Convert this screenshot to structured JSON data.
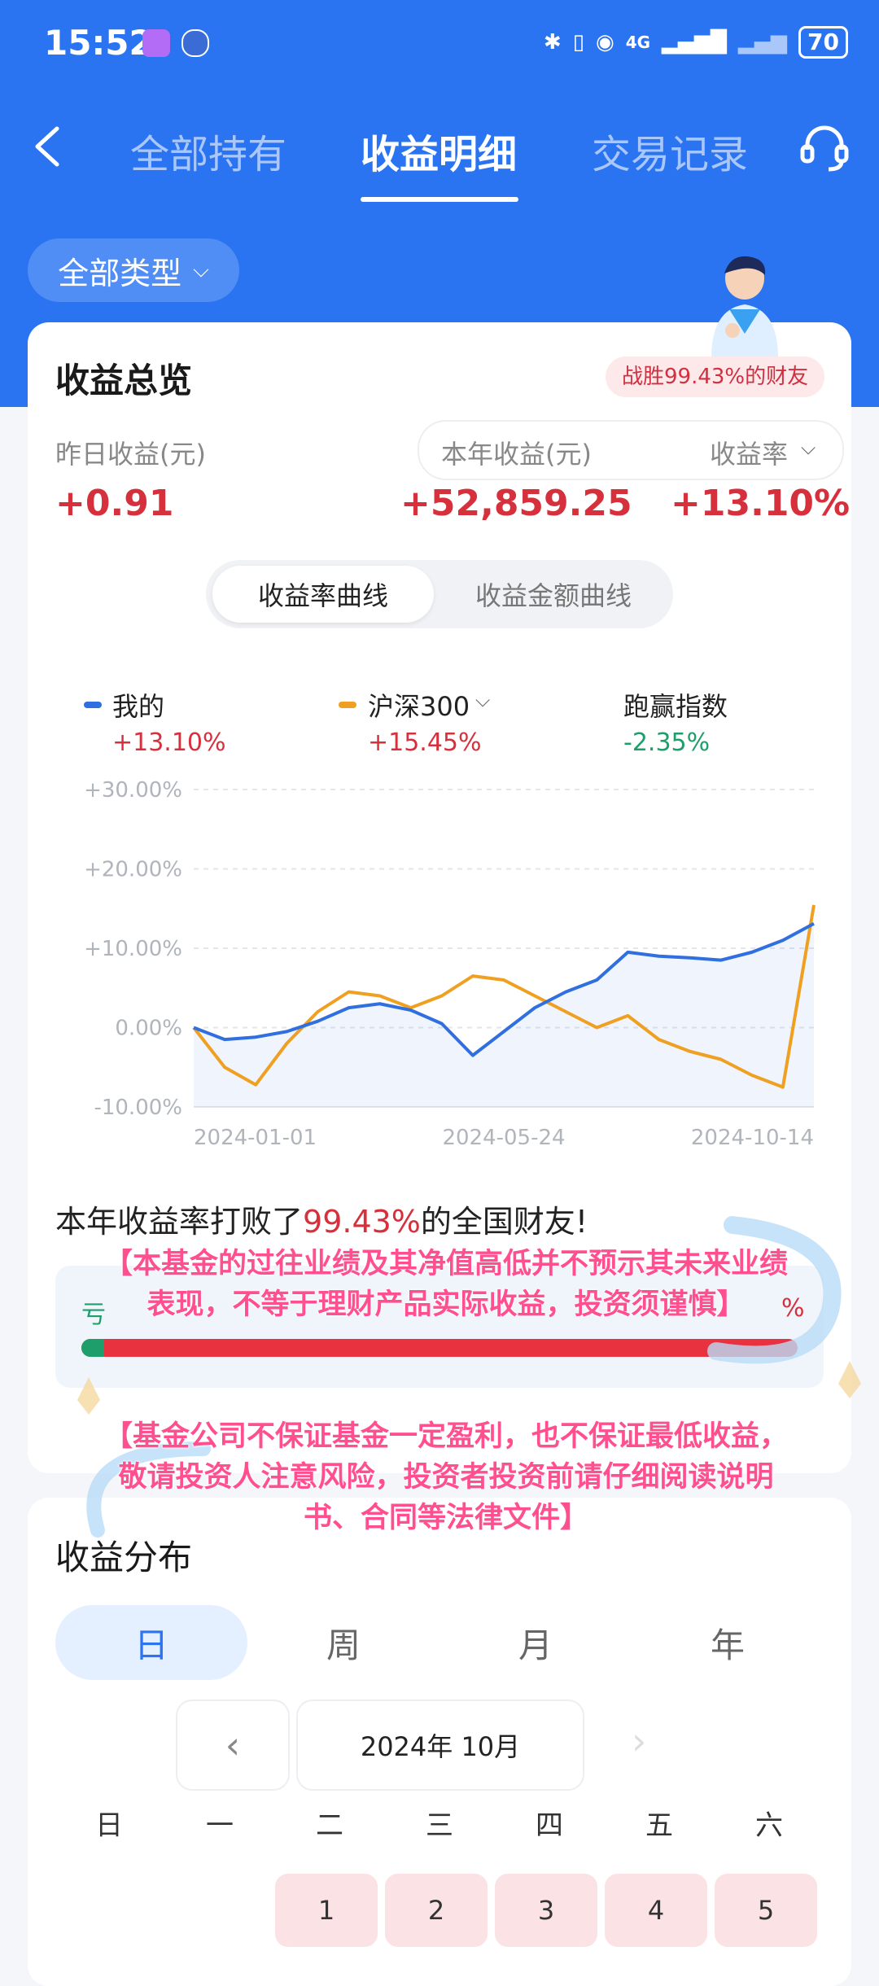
{
  "status_bar": {
    "time": "15:52",
    "network": "4G",
    "battery": "70"
  },
  "nav": {
    "tabs": [
      "全部持有",
      "收益明细",
      "交易记录"
    ],
    "active_tab": "收益明细"
  },
  "filter": {
    "label": "全部类型"
  },
  "overview": {
    "title": "收益总览",
    "badge": "战胜99.43%的财友",
    "yesterday_label": "昨日收益(元)",
    "yesterday_value": "+0.91",
    "year_label": "本年收益(元)",
    "year_value": "+52,859.25",
    "rate_label": "收益率",
    "rate_value": "+13.10%",
    "curve_tabs": [
      "收益率曲线",
      "收益金额曲线"
    ]
  },
  "legend": [
    {
      "name": "我的",
      "value": "+13.10%",
      "color": "#2f6fe0"
    },
    {
      "name": "沪深300",
      "value": "+15.45%",
      "color": "#f0a020"
    },
    {
      "name": "跑赢指数",
      "value": "-2.35%",
      "color": "#1e9e6a"
    }
  ],
  "chart_data": {
    "type": "line",
    "y_ticks": [
      "+30.00%",
      "+20.00%",
      "+10.00%",
      "0.00%",
      "-10.00%"
    ],
    "ylim": [
      -10,
      30
    ],
    "x_ticks": [
      "2024-01-01",
      "2024-05-24",
      "2024-10-14"
    ],
    "x": [
      0,
      20,
      40,
      60,
      80,
      100,
      120,
      140,
      160,
      180,
      200,
      220,
      240,
      260,
      280,
      300,
      320,
      340,
      360,
      380,
      400
    ],
    "series": [
      {
        "name": "我的",
        "color": "#2f6fe0",
        "values": [
          0,
          -1.5,
          -1.2,
          -0.5,
          0.8,
          2.5,
          3.0,
          2.2,
          0.5,
          -3.5,
          -0.5,
          2.5,
          4.5,
          6.0,
          9.5,
          9.0,
          8.8,
          8.5,
          9.5,
          11.0,
          13.1
        ]
      },
      {
        "name": "沪深300",
        "color": "#f0a020",
        "values": [
          0,
          -5.0,
          -7.2,
          -2.0,
          2.0,
          4.5,
          4.0,
          2.5,
          4.0,
          6.5,
          6.0,
          4.0,
          2.0,
          0.0,
          1.5,
          -1.5,
          -3.0,
          -4.0,
          -6.0,
          -7.5,
          15.45
        ]
      }
    ]
  },
  "beat": {
    "prefix": "本年收益率打败了",
    "percent": "99.43%",
    "suffix": "的全国财友!"
  },
  "bar": {
    "left_label": "亏",
    "right_label": "%",
    "loss_share": 0.0057
  },
  "disclaimers": {
    "first": "【本基金的过往业绩及其净值高低并不预示其未来业绩表现，不等于理财产品实际收益，投资须谨慎】",
    "second": "【基金公司不保证基金一定盈利，也不保证最低收益，敬请投资人注意风险，投资者投资前请仔细阅读说明书、合同等法律文件】"
  },
  "distribution": {
    "title": "收益分布",
    "periods": [
      "日",
      "周",
      "月",
      "年"
    ],
    "month": "2024年 10月",
    "weekdays": [
      "日",
      "一",
      "二",
      "三",
      "四",
      "五",
      "六"
    ],
    "days": [
      "1",
      "2",
      "3",
      "4",
      "5"
    ]
  }
}
